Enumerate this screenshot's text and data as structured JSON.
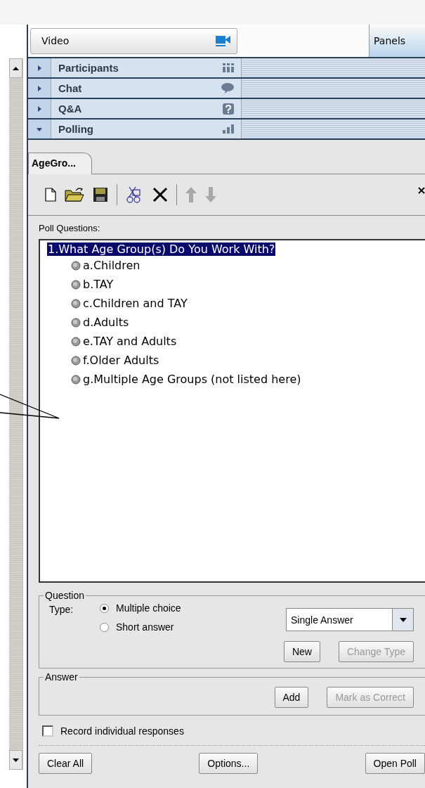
{
  "header": {
    "video_label": "Video",
    "panels_label": "Panels"
  },
  "sections": [
    {
      "label": "Participants",
      "expanded": false
    },
    {
      "label": "Chat",
      "expanded": false
    },
    {
      "label": "Q&A",
      "expanded": false
    },
    {
      "label": "Polling",
      "expanded": true
    }
  ],
  "poll_tab": {
    "label": "AgeGro...",
    "selected": true
  },
  "poll_questions_label": "Poll Questions:",
  "question": {
    "text": "1.What Age Group(s) Do You Work With?",
    "selected": true,
    "answers": [
      "a.Children",
      "b.TAY",
      "c.Children and TAY",
      "d.Adults",
      "e.TAY and Adults",
      "f.Older Adults",
      "g.Multiple Age Groups (not listed here)"
    ]
  },
  "question_group": {
    "title": "Question",
    "type_label": "Type:",
    "options": [
      {
        "label": "Multiple choice",
        "selected": true
      },
      {
        "label": "Short answer",
        "selected": false
      }
    ],
    "answer_mode": "Single Answer",
    "buttons": [
      {
        "label": "New",
        "disabled": false
      },
      {
        "label": "Change Type",
        "disabled": true
      }
    ]
  },
  "answer_group": {
    "title": "Answer",
    "buttons": [
      {
        "label": "Add",
        "disabled": false
      },
      {
        "label": "Mark as Correct",
        "disabled": true
      }
    ]
  },
  "record_responses": {
    "label": "Record individual responses",
    "checked": false
  },
  "footer_buttons": [
    "Clear All",
    "Options...",
    "Open Poll"
  ]
}
